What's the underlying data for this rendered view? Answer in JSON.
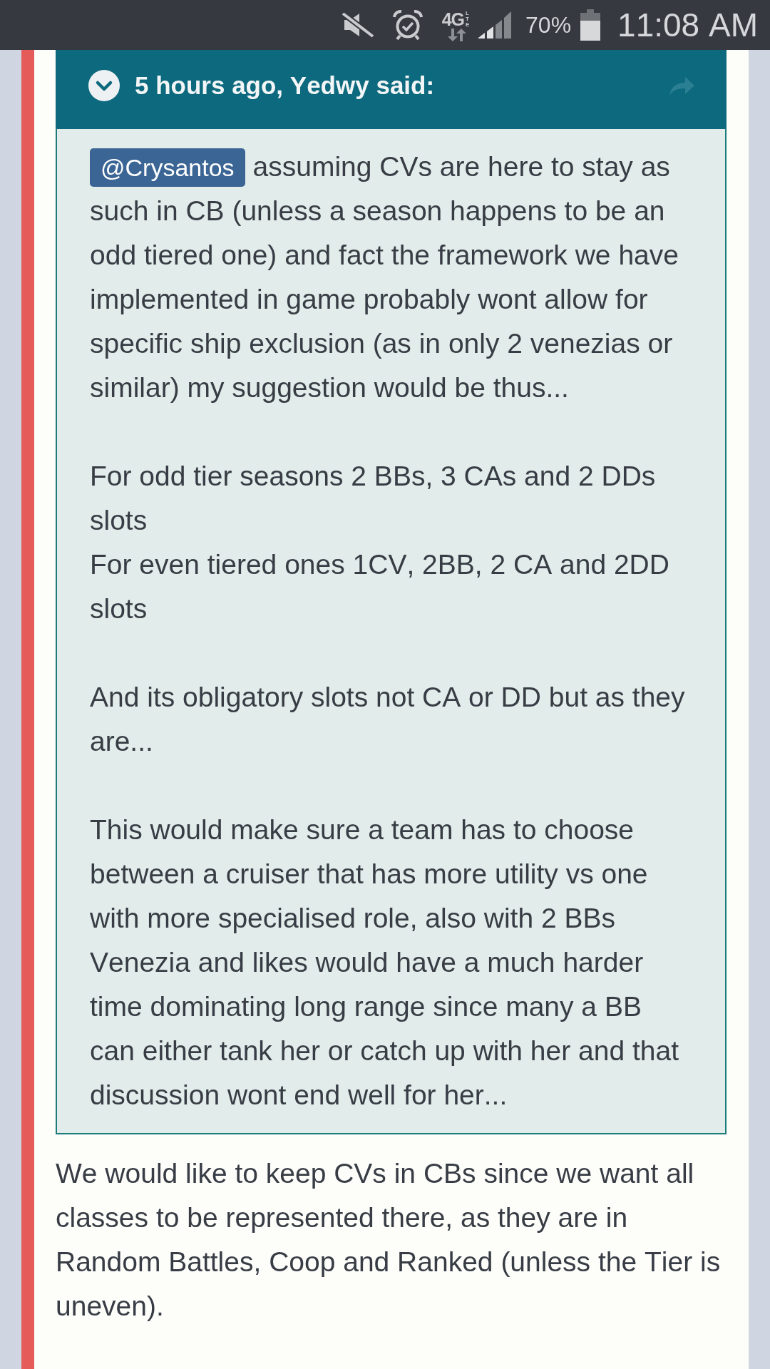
{
  "status_bar": {
    "network_type": "4G",
    "network_sub": "LTE",
    "battery": "70%",
    "time": "11:08 AM"
  },
  "quote": {
    "header": "5 hours ago, Yedwy said:",
    "paragraphs": [
      {
        "mention": "@Crysantos",
        "text": "assuming CVs are here to stay as such in CB (unless a season happens to be an odd tiered one) and fact the framework we have implemented in game probably wont allow for specific ship exclusion (as in only 2 venezias or similar) my suggestion would be thus..."
      },
      {
        "text": "For odd tier seasons 2 BBs, 3 CAs and 2 DDs slots\nFor even tiered ones 1CV, 2BB, 2 CA and 2DD slots"
      },
      {
        "text": "And its obligatory slots not CA or DD but as they are..."
      },
      {
        "text": "This would make sure a team has to choose between a cruiser that has more utility vs one with more specialised role, also with 2 BBs Venezia and likes would have a much harder time dominating long range since many a BB can either tank her or catch up with her and that discussion wont end well for her..."
      }
    ]
  },
  "reply": {
    "paragraphs": [
      "We would like to keep CVs in CBs since we want all classes to be represented there, as they are in Random Battles, Coop and Ranked (unless the Tier is uneven)."
    ]
  }
}
